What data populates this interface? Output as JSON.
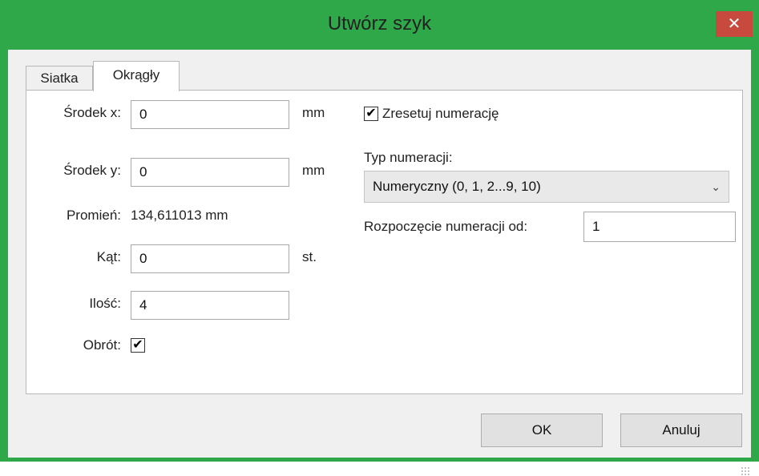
{
  "window": {
    "title": "Utwórz szyk",
    "close_symbol": "✕"
  },
  "tabs": [
    {
      "label": "Siatka",
      "active": false
    },
    {
      "label": "Okrągły",
      "active": true
    }
  ],
  "left": {
    "center_x_label": "Środek x:",
    "center_x_value": "0",
    "center_x_unit": "mm",
    "center_y_label": "Środek y:",
    "center_y_value": "0",
    "center_y_unit": "mm",
    "radius_label": "Promień:",
    "radius_value": "134,611013 mm",
    "angle_label": "Kąt:",
    "angle_value": "0",
    "angle_unit": "st.",
    "count_label": "Ilość:",
    "count_value": "4",
    "rotation_label": "Obrót:",
    "rotation_checked": true
  },
  "right": {
    "reset_label": "Zresetuj numerację",
    "reset_checked": true,
    "numbering_type_label": "Typ numeracji:",
    "numbering_type_value": "Numeryczny (0, 1, 2...9, 10)",
    "start_label": "Rozpoczęcie numeracji od:",
    "start_value": "1"
  },
  "buttons": {
    "ok": "OK",
    "cancel": "Anuluj"
  },
  "colors": {
    "titlebar": "#2fa84a",
    "close": "#c84a3e",
    "client": "#f0f0f0"
  }
}
